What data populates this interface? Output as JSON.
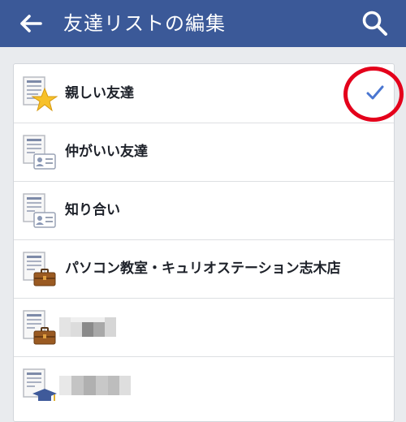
{
  "header": {
    "title": "友達リストの編集",
    "back_icon": "back-arrow-icon",
    "search_icon": "search-icon",
    "bg_color": "#3b5998"
  },
  "lists": [
    {
      "label": "親しい友達",
      "icon": "list-star-icon",
      "selected": true
    },
    {
      "label": "仲がいい友達",
      "icon": "list-contact-card-icon",
      "selected": false
    },
    {
      "label": "知り合い",
      "icon": "list-contact-card-icon",
      "selected": false
    },
    {
      "label": "パソコン教室・キュリオステーション志木店",
      "icon": "list-briefcase-icon",
      "selected": false
    },
    {
      "label": "",
      "icon": "list-briefcase-icon",
      "selected": false,
      "redacted": true
    },
    {
      "label": "",
      "icon": "list-graduation-cap-icon",
      "selected": false,
      "redacted": true
    }
  ],
  "selection": {
    "checkmark_color": "#4a76d1",
    "highlight_color": "#e4001b"
  }
}
